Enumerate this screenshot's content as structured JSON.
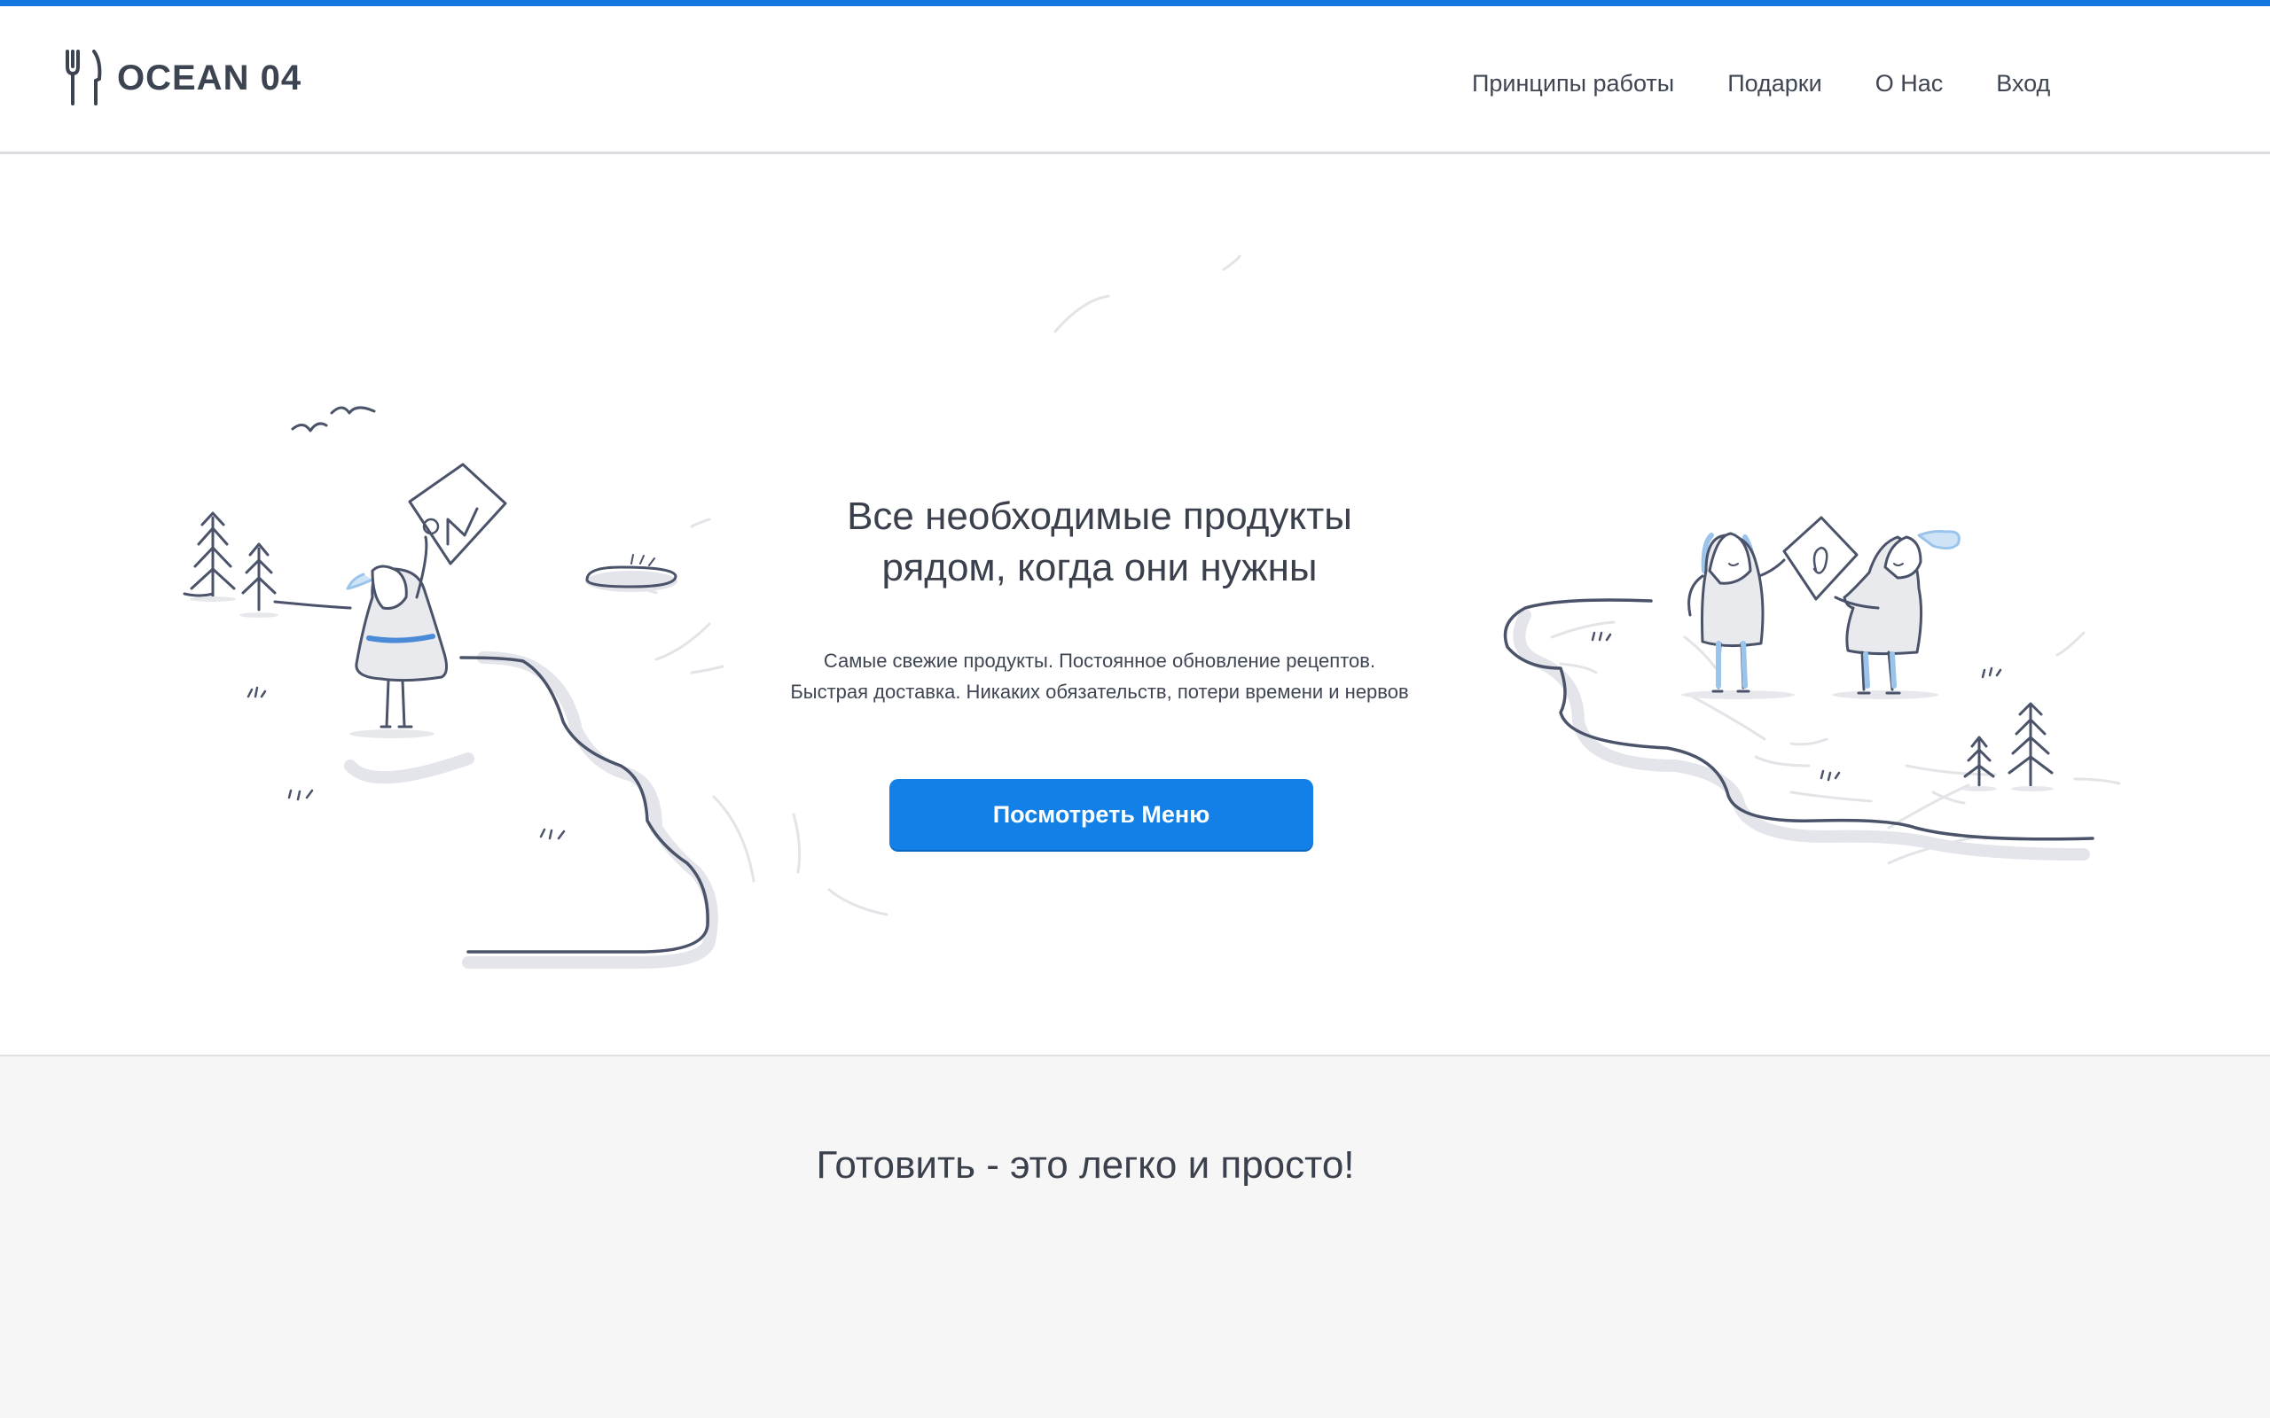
{
  "colors": {
    "accent": "#1477e0",
    "button": "#1280e6",
    "text": "#3f4653",
    "section_bg": "#f6f6f6"
  },
  "header": {
    "logo_icon": "fork-knife-icon",
    "logo_text": "OCEAN 04",
    "nav": [
      {
        "label": "Принципы работы"
      },
      {
        "label": "Подарки"
      },
      {
        "label": "О Нас"
      },
      {
        "label": "Вход"
      }
    ]
  },
  "hero": {
    "title_line1": "Все необходимые продукты",
    "title_line2": "рядом, когда они нужны",
    "subtitle_line1": "Самые свежие продукты. Постоянное обновление рецептов.",
    "subtitle_line2": "Быстрая доставка. Никаких обязательств, потери времени и нервов",
    "cta_label": "Посмотреть Меню"
  },
  "section2": {
    "title": "Готовить - это легко и просто!"
  }
}
